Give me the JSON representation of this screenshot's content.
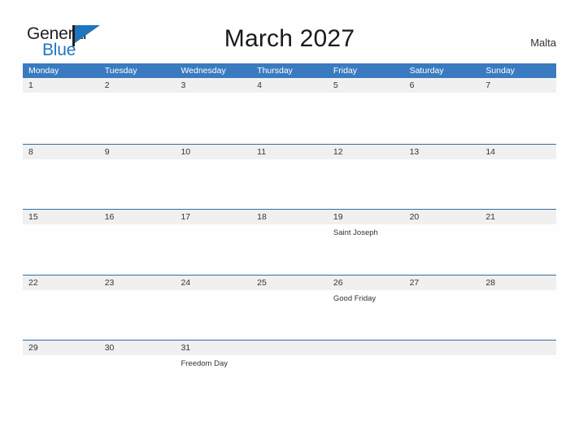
{
  "logo": {
    "word_top": "General",
    "word_bottom": "Blue",
    "flag_icon": "blue-flag-icon",
    "brand_color": "#1f76bc",
    "text_color": "#231f20"
  },
  "header": {
    "title": "March 2027",
    "location": "Malta"
  },
  "colors": {
    "header_blue": "#3a7ac0",
    "row_border_blue": "#2e6da4",
    "day_band_gray": "#f0f0f0",
    "page_background": "#fefefe"
  },
  "calendar": {
    "weekdays": [
      "Monday",
      "Tuesday",
      "Wednesday",
      "Thursday",
      "Friday",
      "Saturday",
      "Sunday"
    ],
    "weeks": [
      [
        {
          "day": "1",
          "event": ""
        },
        {
          "day": "2",
          "event": ""
        },
        {
          "day": "3",
          "event": ""
        },
        {
          "day": "4",
          "event": ""
        },
        {
          "day": "5",
          "event": ""
        },
        {
          "day": "6",
          "event": ""
        },
        {
          "day": "7",
          "event": ""
        }
      ],
      [
        {
          "day": "8",
          "event": ""
        },
        {
          "day": "9",
          "event": ""
        },
        {
          "day": "10",
          "event": ""
        },
        {
          "day": "11",
          "event": ""
        },
        {
          "day": "12",
          "event": ""
        },
        {
          "day": "13",
          "event": ""
        },
        {
          "day": "14",
          "event": ""
        }
      ],
      [
        {
          "day": "15",
          "event": ""
        },
        {
          "day": "16",
          "event": ""
        },
        {
          "day": "17",
          "event": ""
        },
        {
          "day": "18",
          "event": ""
        },
        {
          "day": "19",
          "event": "Saint Joseph"
        },
        {
          "day": "20",
          "event": ""
        },
        {
          "day": "21",
          "event": ""
        }
      ],
      [
        {
          "day": "22",
          "event": ""
        },
        {
          "day": "23",
          "event": ""
        },
        {
          "day": "24",
          "event": ""
        },
        {
          "day": "25",
          "event": ""
        },
        {
          "day": "26",
          "event": "Good Friday"
        },
        {
          "day": "27",
          "event": ""
        },
        {
          "day": "28",
          "event": ""
        }
      ],
      [
        {
          "day": "29",
          "event": ""
        },
        {
          "day": "30",
          "event": ""
        },
        {
          "day": "31",
          "event": "Freedom Day"
        },
        {
          "day": "",
          "event": ""
        },
        {
          "day": "",
          "event": ""
        },
        {
          "day": "",
          "event": ""
        },
        {
          "day": "",
          "event": ""
        }
      ]
    ]
  }
}
